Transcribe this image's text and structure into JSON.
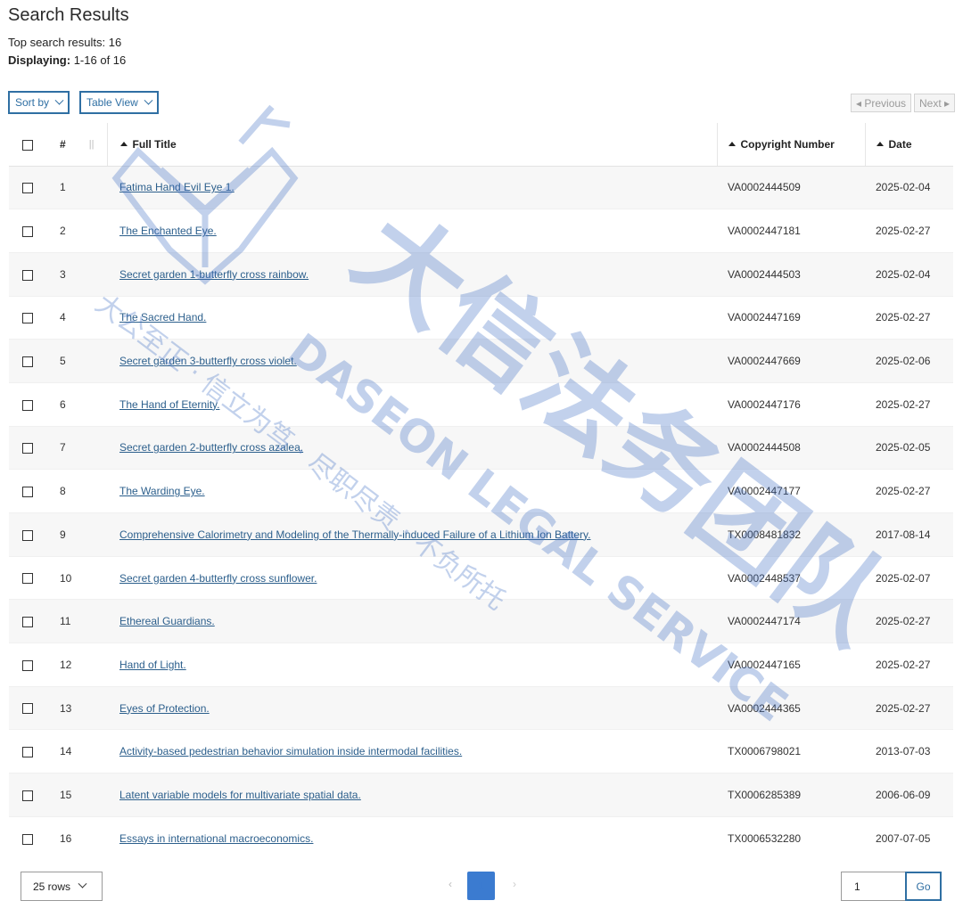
{
  "header": {
    "title": "Search Results",
    "top_results_text": "Top search results: 16",
    "displaying_label": "Displaying:",
    "displaying_value": "1-16 of 16"
  },
  "toolbar": {
    "sort_label": "Sort by",
    "view_label": "Table View",
    "prev_label": "◂ Previous",
    "next_label": "Next ▸"
  },
  "table": {
    "columns": {
      "num": "#",
      "title": "Full Title",
      "copyright": "Copyright Number",
      "date": "Date"
    },
    "rows": [
      {
        "num": "1",
        "title": "Fatima Hand Evil Eye 1.",
        "copyright": "VA0002444509",
        "date": "2025-02-04"
      },
      {
        "num": "2",
        "title": "The Enchanted Eye.",
        "copyright": "VA0002447181",
        "date": "2025-02-27"
      },
      {
        "num": "3",
        "title": "Secret garden 1-butterfly cross rainbow.",
        "copyright": "VA0002444503",
        "date": "2025-02-04"
      },
      {
        "num": "4",
        "title": "The Sacred Hand.",
        "copyright": "VA0002447169",
        "date": "2025-02-27"
      },
      {
        "num": "5",
        "title": "Secret garden 3-butterfly cross violet.",
        "copyright": "VA0002447669",
        "date": "2025-02-06"
      },
      {
        "num": "6",
        "title": "The Hand of Eternity.",
        "copyright": "VA0002447176",
        "date": "2025-02-27"
      },
      {
        "num": "7",
        "title": "Secret garden 2-butterfly cross azalea.",
        "copyright": "VA0002444508",
        "date": "2025-02-05"
      },
      {
        "num": "8",
        "title": "The Warding Eye.",
        "copyright": "VA0002447177",
        "date": "2025-02-27"
      },
      {
        "num": "9",
        "title": "Comprehensive Calorimetry and Modeling of the Thermally-induced Failure of a Lithium Ion Battery.",
        "copyright": "TX0008481832",
        "date": "2017-08-14"
      },
      {
        "num": "10",
        "title": "Secret garden 4-butterfly cross sunflower.",
        "copyright": "VA0002448537",
        "date": "2025-02-07"
      },
      {
        "num": "11",
        "title": "Ethereal Guardians.",
        "copyright": "VA0002447174",
        "date": "2025-02-27"
      },
      {
        "num": "12",
        "title": "Hand of Light.",
        "copyright": "VA0002447165",
        "date": "2025-02-27"
      },
      {
        "num": "13",
        "title": "Eyes of Protection.",
        "copyright": "VA0002444365",
        "date": "2025-02-27"
      },
      {
        "num": "14",
        "title": "Activity-based pedestrian behavior simulation inside intermodal facilities.",
        "copyright": "TX0006798021",
        "date": "2013-07-03"
      },
      {
        "num": "15",
        "title": "Latent variable models for multivariate spatial data.",
        "copyright": "TX0006285389",
        "date": "2006-06-09"
      },
      {
        "num": "16",
        "title": "Essays in international macroeconomics.",
        "copyright": "TX0006532280",
        "date": "2007-07-05"
      }
    ]
  },
  "footer": {
    "rows_select": "25 rows",
    "current_page": "1",
    "go_input_value": "1",
    "go_label": "Go"
  },
  "watermark": {
    "main_text": "大信法务团队",
    "english_text": "DASEON LEGAL SERVICE",
    "slogan_text": "大公至正 · 信立为笃 · 尽职尽责 · 不负所托",
    "color": "#3f6fc4"
  }
}
